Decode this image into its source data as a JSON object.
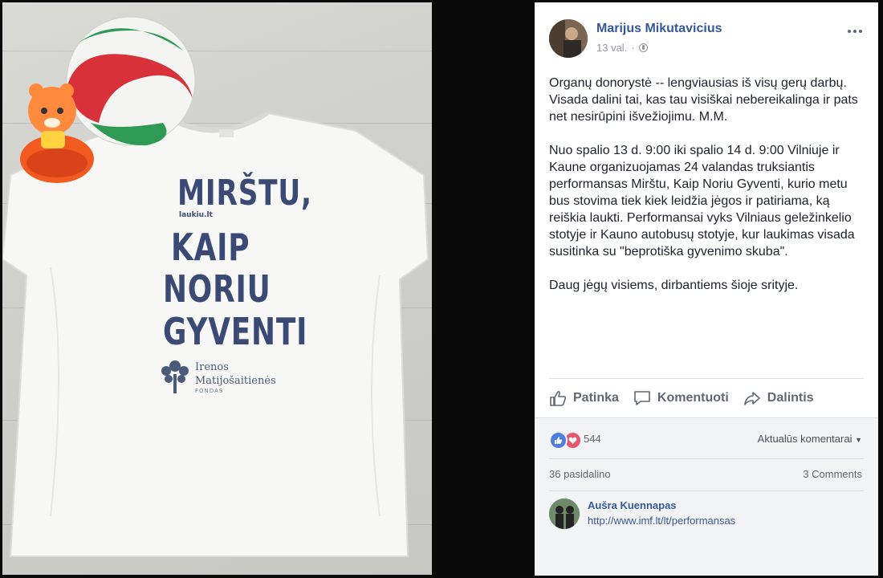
{
  "photo": {
    "shirt_line1": "MIRŠTU,",
    "shirt_url": "laukiu.lt",
    "shirt_line2": "KAIP",
    "shirt_line3": "NORIU",
    "shirt_line4": "GYVENTI",
    "fund_name_1": "Irenos",
    "fund_name_2": "Matijošaitienės",
    "fund_sub": "FONDAS"
  },
  "post": {
    "author": "Marijus Mikutavicius",
    "time": "13 val.",
    "separator": "·",
    "paragraphs": [
      "Organų donorystė -- lengviausias iš visų gerų darbų. Visada dalini tai, kas tau visiškai nebereikalinga ir pats net nesirūpini išvežiojimu. M.M.",
      "Nuo spalio 13 d. 9:00 iki spalio 14 d. 9:00 Vilniuje ir Kaune organizuojamas 24 valandas truksiantis performansas Mirštu, Kaip Noriu Gyventi, kurio metu bus stovima tiek kiek leidžia jėgos ir patiriama, ką reiškia laukti. Performansai vyks Vilniaus geležinkelio stotyje ir Kauno autobusų stotyje, kur laukimas visada susitinka su \"beprotiška gyvenimo skuba\".",
      "Daug jėgų visiems, dirbantiems šioje srityje."
    ],
    "actions": {
      "like": "Patinka",
      "comment": "Komentuoti",
      "share": "Dalintis"
    },
    "reaction_count": "544",
    "sort_label": "Aktualūs komentarai",
    "shares": "36 pasidalino",
    "comments_count": "3 Comments",
    "comment": {
      "author": "Aušra Kuennapas",
      "link": "http://www.imf.lt/lt/performansas"
    }
  },
  "colors": {
    "link_blue": "#365899",
    "like_blue": "#4f7ee3",
    "love_red": "#e9556b",
    "shirt_ink": "#3a4a74"
  }
}
